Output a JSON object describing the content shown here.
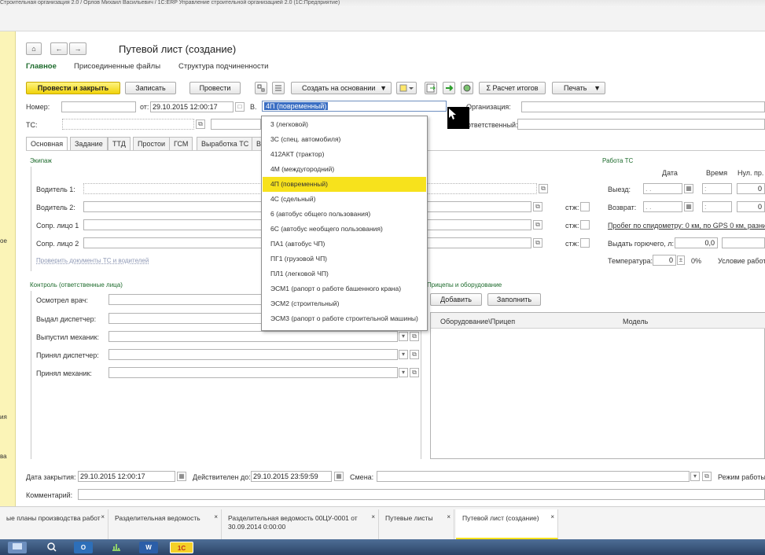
{
  "app": {
    "title_bar": "Строительная организация 2.0 / Орлов Михаил Васильевич / 1С:ERP Управление строительной организацией 2.0 (1С:Предприятие)"
  },
  "left_panel": {
    "fragments": [
      "ое",
      "ия",
      "ва"
    ]
  },
  "header": {
    "title": "Путевой лист (создание)",
    "home_icon": "⌂",
    "back_icon": "←",
    "forward_icon": "→",
    "nav": [
      "Главное",
      "Присоединенные файлы",
      "Структура подчиненности"
    ]
  },
  "toolbar": {
    "post_close": "Провести и закрыть",
    "save": "Записать",
    "post": "Провести",
    "create_based": "Создать на основании",
    "calc_totals": "Σ Расчет итогов",
    "print": "Печать"
  },
  "fields": {
    "number_label": "Номер:",
    "date_label": "от:",
    "date_value": "29.10.2015 12:00:17",
    "type_label": "В.",
    "type_value": "4П (повременный)",
    "org_label": "Организация:",
    "vehicle_label": "ТС:",
    "resp_label": "ответственный:"
  },
  "tabs": [
    "Основная",
    "Задание",
    "ТТД",
    "Простои",
    "ГСМ",
    "Выработка ТС",
    "В"
  ],
  "crew": {
    "title": "Экипаж",
    "driver1": "Водитель 1:",
    "driver2": "Водитель 2:",
    "comp1": "Сопр. лицо 1",
    "comp2": "Сопр. лицо 2",
    "stzh": "стж:",
    "check_link": "Проверить документы ТС и водителей"
  },
  "control": {
    "title": "Контроль (ответственные лица)",
    "rows": [
      "Осмотрел врач:",
      "Выдал диспетчер:",
      "Выпустил механик:",
      "Принял диспетчер:",
      "Принял механик:"
    ]
  },
  "work": {
    "title": "Работа ТС",
    "col_date": "Дата",
    "col_time": "Время",
    "col_zero": "Нул. пр.",
    "exit": "Выезд:",
    "return": "Возврат:",
    "date_mask": ". .",
    "time_mask": ":",
    "zero_val": "0",
    "mileage": "Пробег по спидометру: 0 км, по GPS 0 км, разниц",
    "fuel_label": "Выдать горючего, л:",
    "fuel_val": "0,0",
    "temp_label": "Температура:",
    "temp_val": "0",
    "pct": "0%",
    "conditions": "Условие работы"
  },
  "trailers": {
    "title": "Прицепы и оборудование",
    "add": "Добавить",
    "fill": "Заполнить",
    "col_equipment": "Оборудование\\Прицеп",
    "col_model": "Модель"
  },
  "bottom": {
    "close_date_label": "Дата закрытия:",
    "close_date": "29.10.2015 12:00:17",
    "valid_label": "Действителен до:",
    "valid_date": "29.10.2015 23:59:59",
    "shift_label": "Смена:",
    "mode_label": "Режим работы:",
    "comment_label": "Комментарий:"
  },
  "dropdown": {
    "items": [
      "3 (легковой)",
      "3С (спец. автомобиля)",
      "412АКТ (трактор)",
      "4М (междугородний)",
      "4П (повременный)",
      "4С (сдельный)",
      "6 (автобус общего пользования)",
      "6С (автобус необщего пользования)",
      "ПА1 (автобус ЧП)",
      "ПГ1 (грузовой ЧП)",
      "ПЛ1 (легковой ЧП)",
      "ЭСМ1 (рапорт о работе башенного крана)",
      "ЭСМ2 (строительный)",
      "ЭСМ3 (рапорт о работе строительной машины)"
    ],
    "selected_index": 4
  },
  "open_windows": [
    {
      "label": "ые планы производства работ"
    },
    {
      "label": "Разделительная ведомость"
    },
    {
      "label": "Разделительная ведомость 00ЦУ-0001 от",
      "label2": "30.09.2014 0:00:00"
    },
    {
      "label": "Путевые листы"
    },
    {
      "label": "Путевой лист (создание)"
    }
  ],
  "taskbar": {
    "labels": [
      "O",
      "W",
      "1С"
    ]
  },
  "colors": {
    "accent_yellow": "#f7e21c",
    "section_green": "#1d6b2c",
    "taskbar": "#2f4a70"
  }
}
